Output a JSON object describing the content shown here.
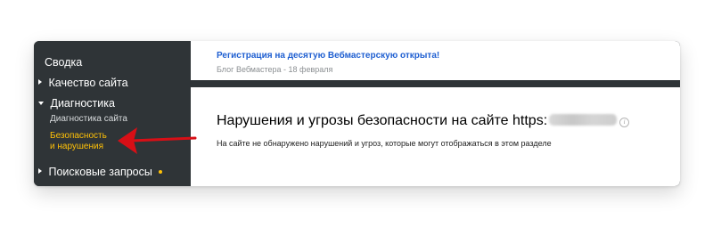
{
  "sidebar": {
    "items": [
      {
        "label": "Сводка"
      },
      {
        "label": "Качество сайта"
      },
      {
        "label": "Диагностика"
      },
      {
        "label": "Диагностика сайта"
      },
      {
        "label_line_1": "Безопасность",
        "label_line_2": "и нарушения"
      },
      {
        "label": "Поисковые запросы"
      }
    ]
  },
  "blog": {
    "link": "Регистрация на десятую Вебмастерскую открыта!",
    "meta": "Блог Вебмастера - 18 февраля"
  },
  "main": {
    "title": "Нарушения и угрозы безопасности на сайте https:",
    "subtitle": "На сайте не обнаружено нарушений и угроз, которые могут отображаться в этом разделе"
  },
  "icons": {
    "info": "i"
  },
  "colors": {
    "sidebar_bg": "#2f3437",
    "accent_yellow": "#ffc107",
    "link_blue": "#1f5fd1",
    "arrow_red": "#d80f16"
  }
}
